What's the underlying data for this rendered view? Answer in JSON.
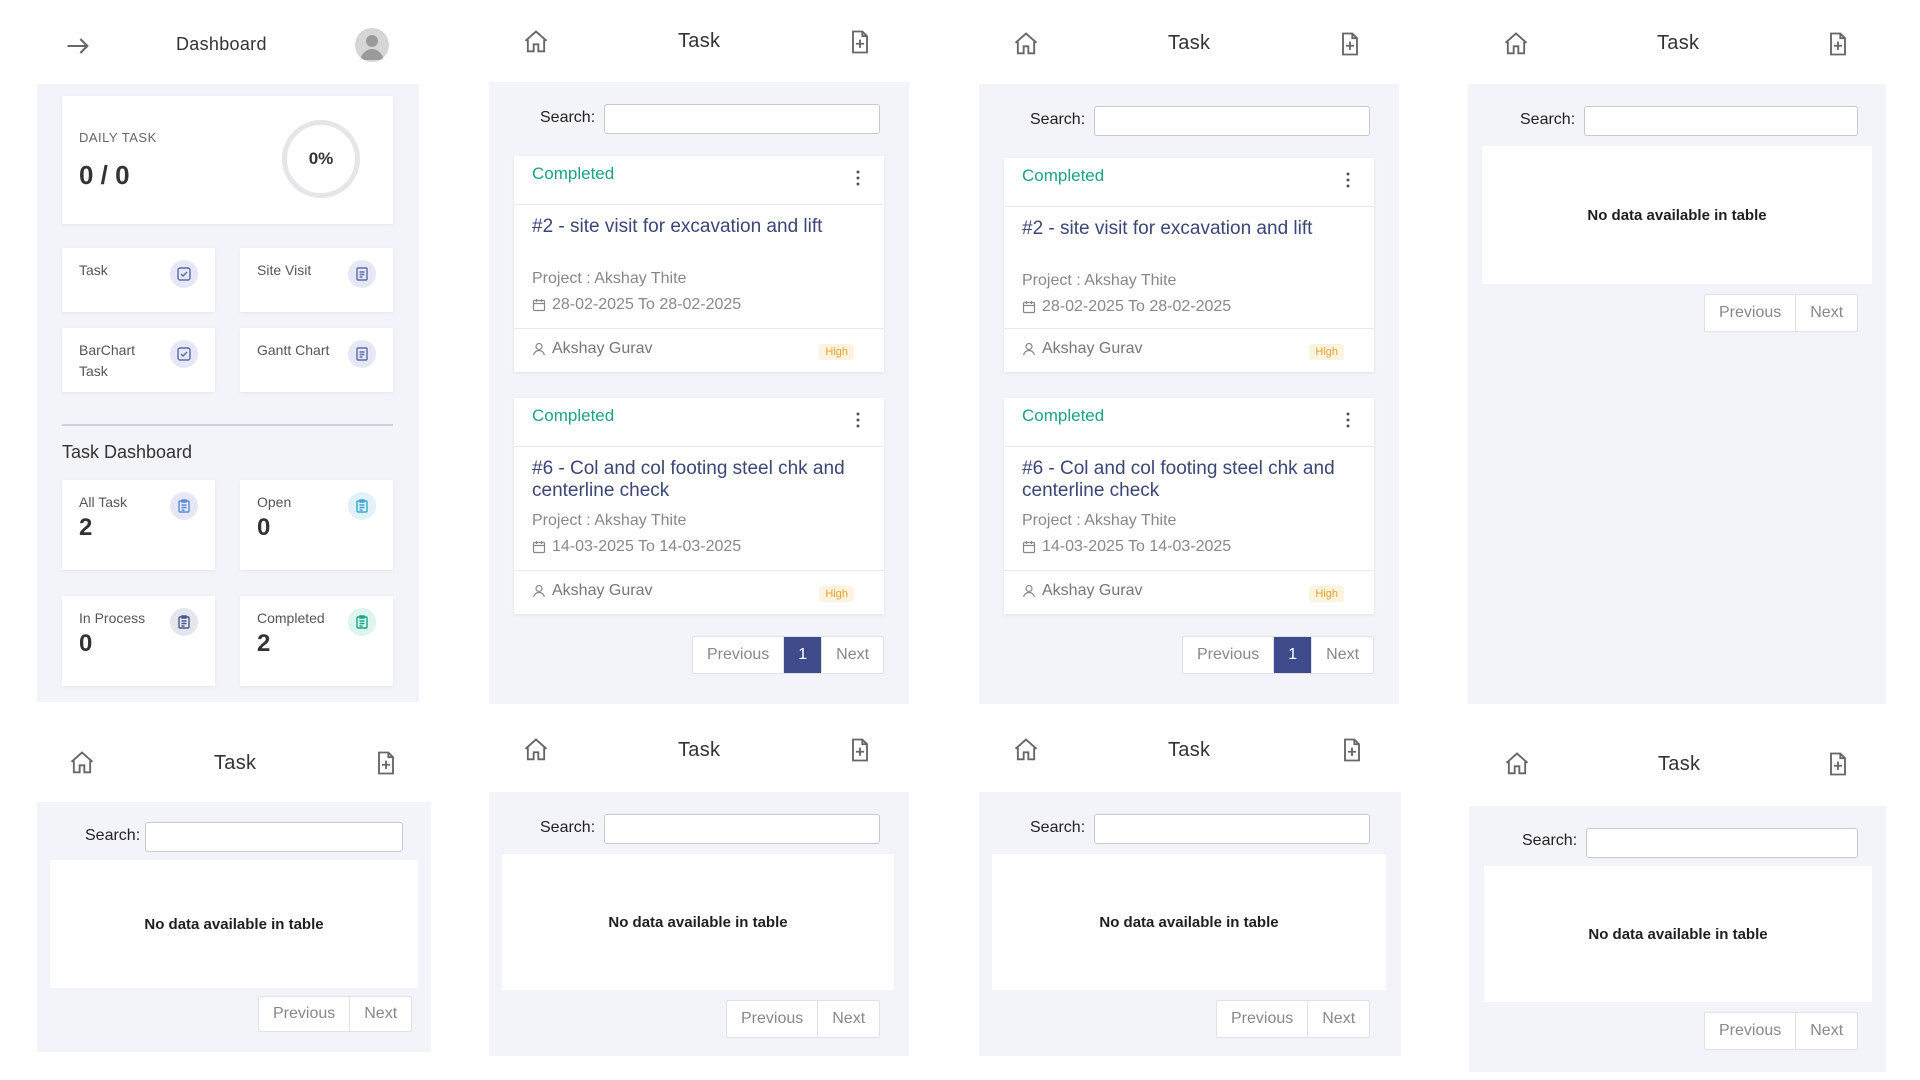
{
  "dashboard": {
    "title": "Dashboard",
    "daily_task": {
      "label": "DAILY TASK",
      "value": "0 / 0",
      "percent": "0%"
    },
    "tiles": [
      {
        "label": "Task",
        "icon": "check-square-icon"
      },
      {
        "label": "Site Visit",
        "icon": "document-icon"
      },
      {
        "label": "BarChart Task",
        "icon": "check-square-icon"
      },
      {
        "label": "Gantt Chart",
        "icon": "document-icon"
      }
    ],
    "section_title": "Task Dashboard",
    "stats": [
      {
        "label": "All Task",
        "value": "2"
      },
      {
        "label": "Open",
        "value": "0"
      },
      {
        "label": "In Process",
        "value": "0"
      },
      {
        "label": "Completed",
        "value": "2"
      }
    ]
  },
  "common": {
    "task_title": "Task",
    "search_label": "Search:",
    "empty_text": "No data available in table",
    "prev_label": "Previous",
    "next_label": "Next",
    "page_1": "1"
  },
  "tasks": [
    {
      "status": "Completed",
      "title": "#2 - site visit for excavation and lift",
      "project": "Project : Akshay Thite",
      "dates": "28-02-2025 To 28-02-2025",
      "user": "Akshay Gurav",
      "priority": "High"
    },
    {
      "status": "Completed",
      "title": "#6 - Col and col footing steel chk and centerline check",
      "project": "Project : Akshay Thite",
      "dates": "14-03-2025 To 14-03-2025",
      "user": "Akshay Gurav",
      "priority": "High"
    }
  ],
  "colors": {
    "accent": "#3f4a8a",
    "completed_green": "#1aa38a",
    "priority_high": "#e7a02a",
    "panel_bg": "#f3f3fa"
  }
}
